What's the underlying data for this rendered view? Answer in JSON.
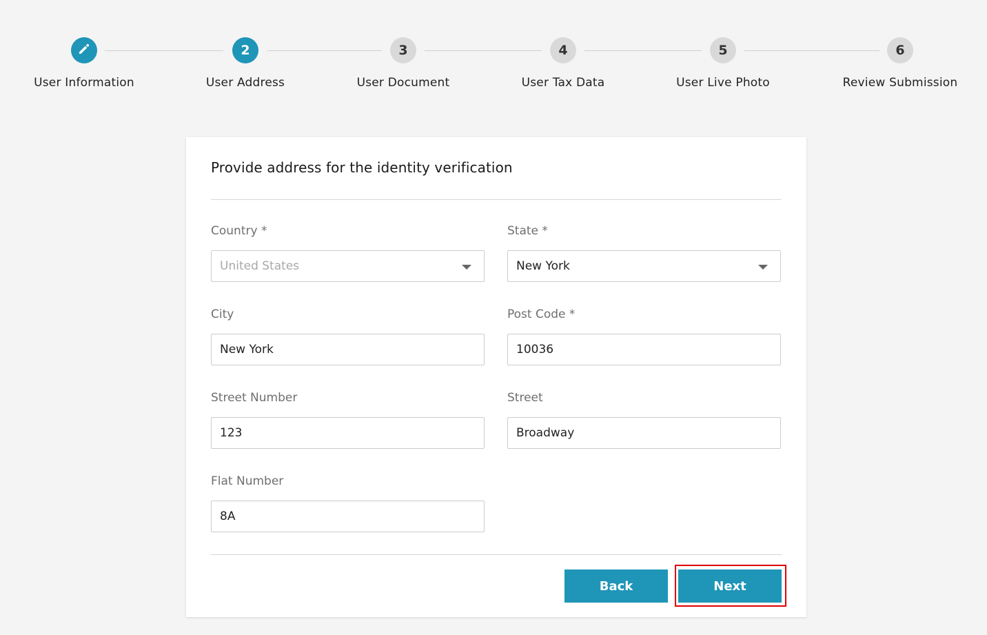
{
  "stepper": {
    "steps": [
      {
        "number": "",
        "label": "User Information",
        "state": "done",
        "icon": "pencil-icon"
      },
      {
        "number": "2",
        "label": "User Address",
        "state": "active"
      },
      {
        "number": "3",
        "label": "User Document",
        "state": "pending"
      },
      {
        "number": "4",
        "label": "User Tax Data",
        "state": "pending"
      },
      {
        "number": "5",
        "label": "User Live Photo",
        "state": "pending"
      },
      {
        "number": "6",
        "label": "Review Submission",
        "state": "pending"
      }
    ]
  },
  "form": {
    "title": "Provide address for the identity verification",
    "country": {
      "label": "Country *",
      "value": "United States",
      "disabled": true
    },
    "state": {
      "label": "State *",
      "value": "New York"
    },
    "city": {
      "label": "City",
      "value": "New York"
    },
    "post_code": {
      "label": "Post Code *",
      "value": "10036"
    },
    "street_number": {
      "label": "Street Number",
      "value": "123"
    },
    "street": {
      "label": "Street",
      "value": "Broadway"
    },
    "flat_number": {
      "label": "Flat Number",
      "value": "8A"
    }
  },
  "actions": {
    "back_label": "Back",
    "next_label": "Next"
  },
  "colors": {
    "accent": "#1f95b8",
    "pending_step": "#d9d9d9",
    "highlight": "#e00000",
    "background": "#f4f4f4"
  }
}
